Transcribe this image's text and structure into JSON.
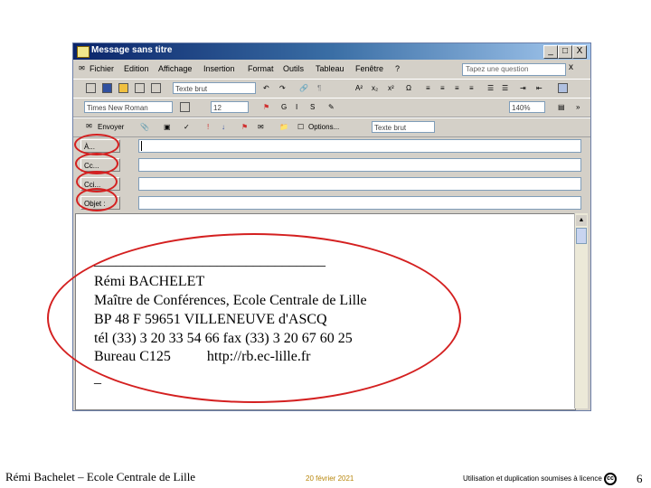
{
  "window": {
    "title": "Message sans titre",
    "buttons": {
      "minimize": "_",
      "maximize": "□",
      "close": "X"
    }
  },
  "menubar": {
    "items": [
      "Fichier",
      "Edition",
      "Affichage",
      "Insertion",
      "Format",
      "Outils",
      "Tableau",
      "Fenêtre",
      "?"
    ],
    "help_placeholder": "Tapez une question",
    "close_label": "x"
  },
  "toolbar_format": {
    "style_value": "Texte brut",
    "font_value": "Times New Roman",
    "size_value": "12",
    "zoom_value": "140%"
  },
  "toolbar_send": {
    "send_label": "Envoyer",
    "options_label": "Options...",
    "format_value": "Texte brut"
  },
  "address": {
    "to_label": "À...",
    "cc_label": "Cc...",
    "bcc_label": "Cci...",
    "subject_label": "Objet :"
  },
  "signature": {
    "rule": "________________________________",
    "name": "Rémi BACHELET",
    "title": "Maître de Conférences, Ecole Centrale de Lille",
    "address": "BP 48   F 59651  VILLENEUVE d'ASCQ",
    "phone": "tél (33) 3 20 33 54 66    fax (33) 3 20 67 60 25",
    "office": "Bureau C125",
    "url": "http://rb.ec-lille.fr",
    "end": "_"
  },
  "footer": {
    "author": "Rémi Bachelet – Ecole Centrale de Lille",
    "date": "20 février 2021",
    "license": "Utilisation et duplication soumises à licence",
    "page": "6"
  },
  "colors": {
    "annotation": "#d42020",
    "titlebar": "#0a246a"
  }
}
